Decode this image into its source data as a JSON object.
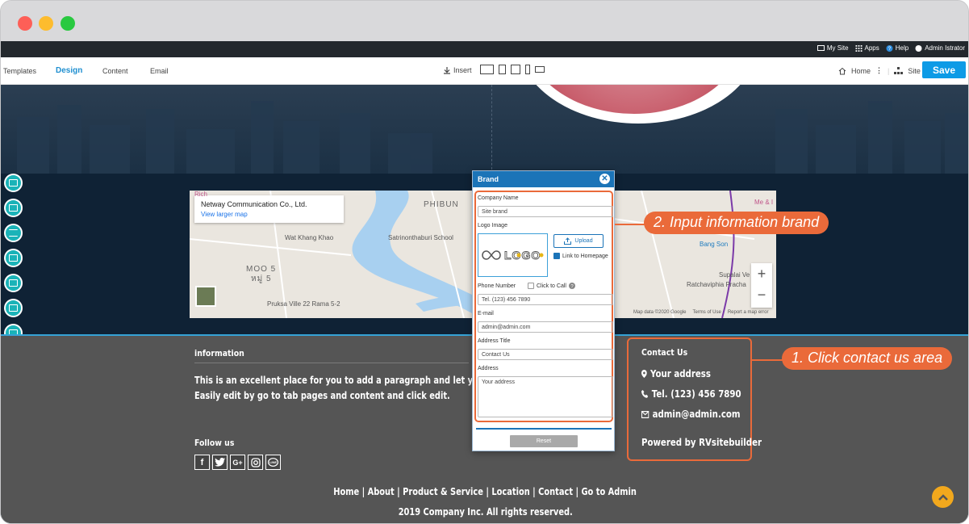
{
  "window": {
    "controls": [
      "close",
      "minimize",
      "maximize"
    ]
  },
  "adminbar": {
    "my_site": "My Site",
    "apps": "Apps",
    "help": "Help",
    "user": "Admin Istrator"
  },
  "toolbar": {
    "tabs": [
      "Templates",
      "Design",
      "Content",
      "Email"
    ],
    "active_tab": "Design",
    "insert": "Insert",
    "home": "Home",
    "site": "Site",
    "save": "Save"
  },
  "map": {
    "company": "Netway Communication Co., Ltd.",
    "link": "View larger map",
    "labels": [
      "Wat Khang Khao",
      "Satrinonthaburi School",
      "PHIBUN",
      "MOO 5",
      "หมู่ 5",
      "Pruksa Ville 22 Rama 5-2",
      "Bang Son",
      "Supalai Ve",
      "Ratchaviphia Pracha",
      "Rich",
      "Me & I"
    ],
    "footer": [
      "Map data ©2020 Google",
      "Terms of Use",
      "Report a map error"
    ]
  },
  "modal": {
    "title": "Brand",
    "company_label": "Company Name",
    "company_value": "Site brand",
    "logo_label": "Logo Image",
    "logo_text": "LOGO",
    "upload": "Upload",
    "link_home": "Link to Homepage",
    "phone_label": "Phone Number",
    "click_to_call": "Click to Call",
    "phone_value": "Tel. (123) 456 7890",
    "email_label": "E-mail",
    "email_value": "admin@admin.com",
    "address_title_label": "Address Title",
    "address_title_value": "Contact Us",
    "address_label": "Address",
    "address_placeholder": "Your address",
    "reset": "Reset"
  },
  "footer": {
    "info_title": "information",
    "info_text_1": "This is an excellent place for you to add a paragraph and let your visitors kn",
    "info_text_2": "Easily edit by go to tab pages and content and click edit.",
    "follow_us": "Follow us",
    "social": [
      "facebook",
      "twitter",
      "google-plus",
      "instagram",
      "line"
    ],
    "contact_title": "Contact Us",
    "address": "Your address",
    "phone": "Tel. (123) 456 7890",
    "email": "admin@admin.com",
    "powered": "Powered by RVsitebuilder",
    "menu": "Home | About | Product & Service | Location | Contact | Go to Admin",
    "copyright": "2019 Company Inc. All rights reserved."
  },
  "callouts": {
    "step1": "1. Click contact us area",
    "step2": "2. Input information brand"
  },
  "colors": {
    "accent": "#0d9be6",
    "callout": "#ea6a3a",
    "footer_bg": "#555555",
    "modal_header": "#1b74b8"
  }
}
